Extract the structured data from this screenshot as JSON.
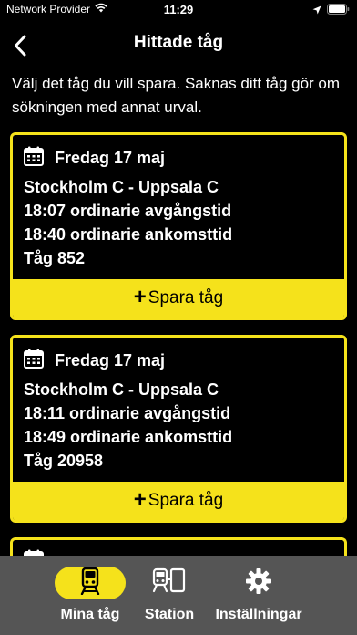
{
  "status": {
    "carrier": "Network Provider",
    "time": "11:29"
  },
  "nav": {
    "title": "Hittade tåg"
  },
  "intro": "Välj det tåg du vill spara. Saknas ditt tåg gör om sökningen med annat urval.",
  "cards": [
    {
      "date": "Fredag 17 maj",
      "route": "Stockholm C - Uppsala C",
      "departure": "18:07 ordinarie avgångstid",
      "arrival": "18:40 ordinarie ankomsttid",
      "train": "Tåg 852",
      "save_label": "Spara tåg"
    },
    {
      "date": "Fredag 17 maj",
      "route": "Stockholm C - Uppsala C",
      "departure": "18:11 ordinarie avgångstid",
      "arrival": "18:49 ordinarie ankomsttid",
      "train": "Tåg 20958",
      "save_label": "Spara tåg"
    }
  ],
  "tabs": [
    {
      "label": "Mina tåg",
      "icon": "train-icon",
      "active": true
    },
    {
      "label": "Station",
      "icon": "station-icon",
      "active": false
    },
    {
      "label": "Inställningar",
      "icon": "gear-icon",
      "active": false
    }
  ],
  "colors": {
    "accent": "#f5e21b",
    "background": "#000000",
    "tab_bar": "#555555"
  }
}
